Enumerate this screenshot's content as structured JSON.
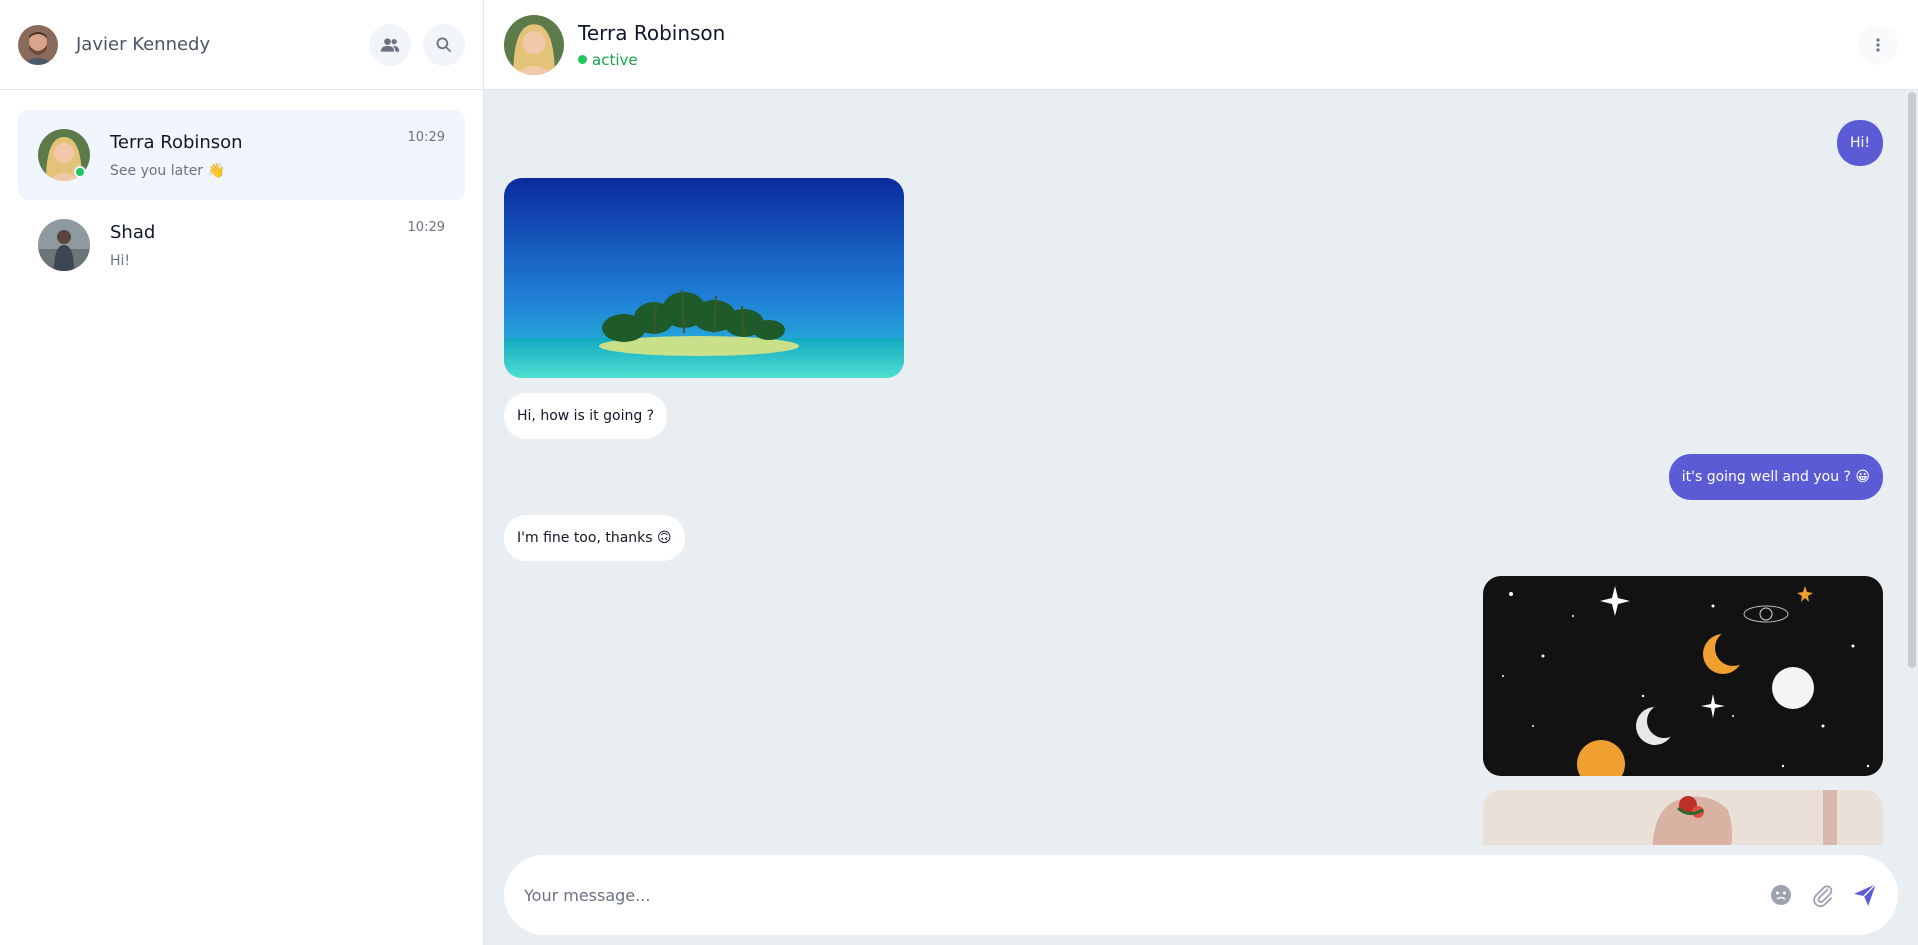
{
  "sidebar": {
    "user_name": "Javier Kennedy",
    "conversations": [
      {
        "name": "Terra Robinson",
        "preview": "See you later 👋",
        "time": "10:29",
        "online": true
      },
      {
        "name": "Shad",
        "preview": "Hi!",
        "time": "10:29",
        "online": false
      }
    ]
  },
  "chat": {
    "contact_name": "Terra Robinson",
    "status": "active",
    "messages": [
      {
        "dir": "out",
        "text": "Hi!"
      },
      {
        "dir": "in",
        "type": "image",
        "image": "tropical-island"
      },
      {
        "dir": "in",
        "text": "Hi, how is it going ?"
      },
      {
        "dir": "out",
        "text": "it's going well and you ? 😀"
      },
      {
        "dir": "in",
        "text": "I'm fine too, thanks 🙃"
      },
      {
        "dir": "out",
        "type": "image",
        "image": "space-moons"
      },
      {
        "dir": "out",
        "type": "image",
        "image": "art-collage"
      }
    ]
  },
  "composer": {
    "placeholder": "Your message..."
  },
  "colors": {
    "accent": "#5b5bd6",
    "online": "#22c55e",
    "background": "#e9eef2"
  }
}
